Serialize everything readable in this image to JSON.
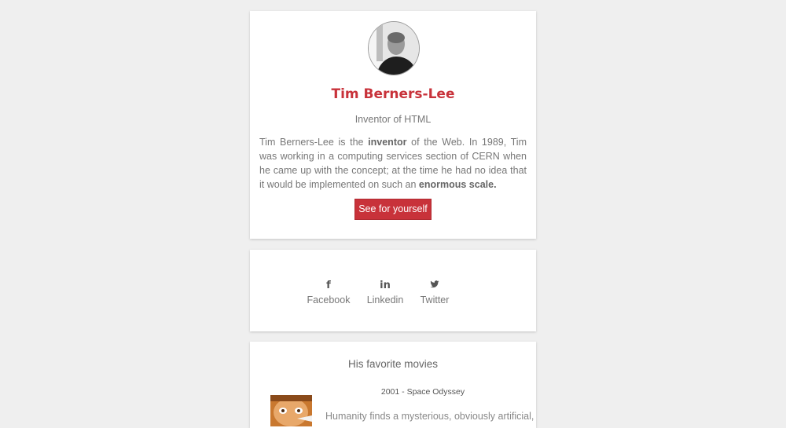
{
  "profile": {
    "name": "Tim Berners-Lee",
    "role": "Inventor of HTML",
    "bio": {
      "part1": "Tim Berners-Lee is the ",
      "bold1": "inventor",
      "part2": " of the Web. In 1989, Tim was working in a computing services section of CERN when he came up with the concept; at the time he had no idea that it would be implemented on such an ",
      "bold2": "enormous scale."
    },
    "cta_label": "See for yourself"
  },
  "social": [
    {
      "icon": "facebook-icon",
      "glyph": "f",
      "label": "Facebook"
    },
    {
      "icon": "linkedin-icon",
      "glyph": "in",
      "label": "Linkedin"
    },
    {
      "icon": "twitter-icon",
      "glyph": "🐦",
      "label": "Twitter"
    }
  ],
  "movies": {
    "title": "His favorite movies",
    "items": [
      {
        "name": "2001 - Space Odyssey",
        "description": "Humanity finds a mysterious, obviously artificial,"
      }
    ]
  },
  "colors": {
    "accent": "#c8323a",
    "background": "#efefef",
    "card": "#ffffff",
    "text": "#777777"
  }
}
